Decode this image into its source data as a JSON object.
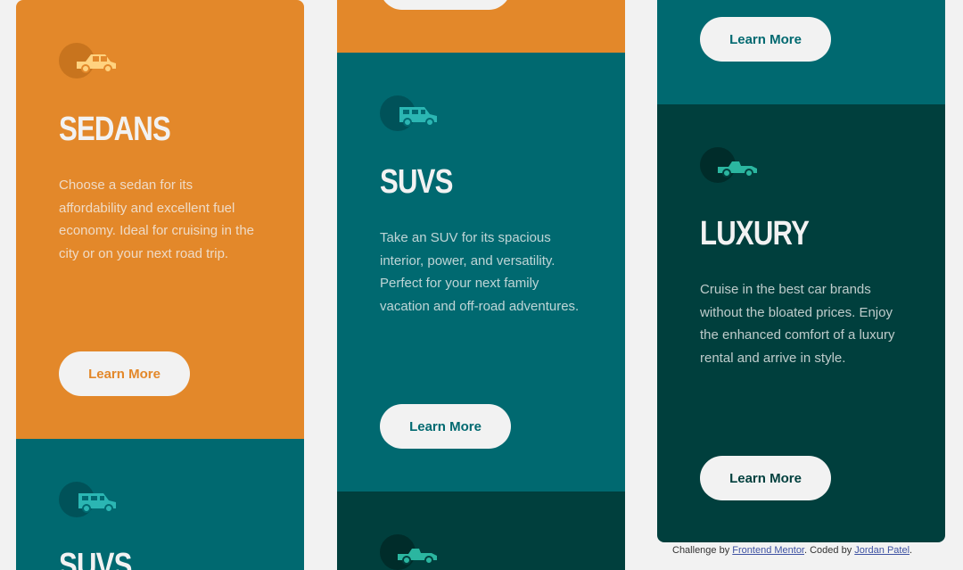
{
  "colors": {
    "orange": "#e3882a",
    "teal": "#006970",
    "dark_teal": "#003f3d",
    "light": "#f2f2f2"
  },
  "cards": {
    "sedans": {
      "icon": "sedan-car-icon",
      "title": "SEDANS",
      "description": "Choose a sedan for its affordability and excellent fuel economy. Ideal for cruising in the city or on your next road trip.",
      "button_label": "Learn More"
    },
    "suvs": {
      "icon": "suv-car-icon",
      "title": "SUVS",
      "description": "Take an SUV for its spacious interior, power, and versatility. Perfect for your next family vacation and off-road adventures.",
      "button_label": "Learn More"
    },
    "luxury": {
      "icon": "convertible-car-icon",
      "title": "LUXURY",
      "description": "Cruise in the best car brands without the bloated prices. Enjoy the enhanced comfort of a luxury rental and arrive in style.",
      "button_label": "Learn More"
    }
  },
  "attribution": {
    "prefix": "Challenge by ",
    "frontend_mentor": "Frontend Mentor",
    "middle": ". Coded by ",
    "author": "Jordan Patel",
    "suffix": "."
  }
}
